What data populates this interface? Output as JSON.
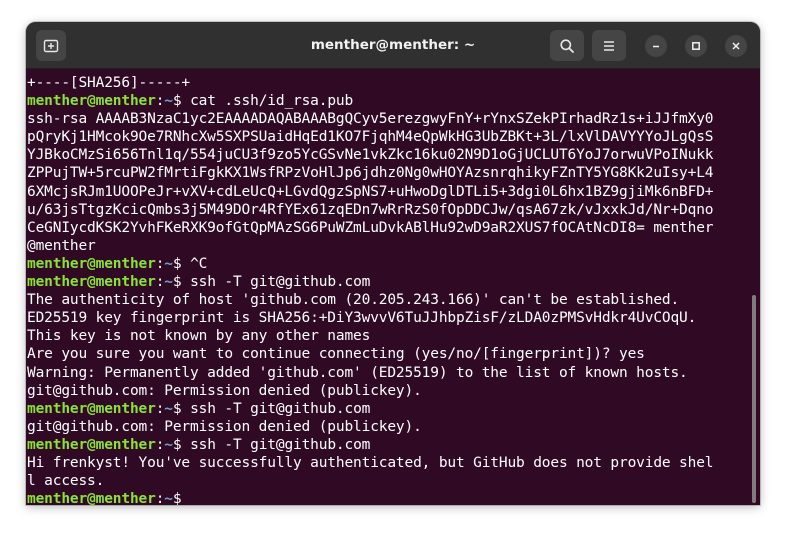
{
  "window": {
    "title": "menther@menther: ~"
  },
  "terminal": {
    "prompt_user_host": "menther@menther",
    "prompt_sep": ":",
    "prompt_path": "~",
    "prompt_symbol": "$",
    "lines": [
      {
        "kind": "output",
        "text": "+----[SHA256]-----+"
      },
      {
        "kind": "prompt",
        "cmd": " cat .ssh/id_rsa.pub"
      },
      {
        "kind": "output",
        "text": "ssh-rsa AAAAB3NzaC1yc2EAAAADAQABAAABgQCyv5erezgwyFnY+rYnxSZekPIrhadRz1s+iJJfmXy0"
      },
      {
        "kind": "output",
        "text": "pQryKj1HMcok9Oe7RNhcXw5SXPSUaidHqEd1KO7FjqhM4eQpWkHG3UbZBKt+3L/lxVlDAVYYYoJLgQsS"
      },
      {
        "kind": "output",
        "text": "YJBkoCMzSi656Tnl1q/554juCU3f9zo5YcGSvNe1vkZkc16ku02N9D1oGjUCLUT6YoJ7orwuVPoINukk"
      },
      {
        "kind": "output",
        "text": "ZPPujTW+5rcuPW2fMrtiFgkKX1WsfRPzVoHlJp6jdhz0Ng0wHOYAzsnrqhikyFZnTY5YG8Kk2uIsy+L4"
      },
      {
        "kind": "output",
        "text": "6XMcjsRJm1UOOPeJr+vXV+cdLeUcQ+LGvdQgzSpNS7+uHwoDglDTLi5+3dgi0L6hx1BZ9gjiMk6nBFD+"
      },
      {
        "kind": "output",
        "text": "u/63jsTtgzKcicQmbs3j5M49DOr4RfYEx61zqEDn7wRrRzS0fOpDDCJw/qsA67zk/vJxxkJd/Nr+Dqno"
      },
      {
        "kind": "output",
        "text": "CeGNIycdKSK2YvhFKeRXK9ofGtQpMAzSG6PuWZmLuDvkABlHu92wD9aR2XUS7fOCAtNcDI8= menther"
      },
      {
        "kind": "output",
        "text": "@menther"
      },
      {
        "kind": "prompt",
        "cmd": " ^C"
      },
      {
        "kind": "prompt",
        "cmd": " ssh -T git@github.com"
      },
      {
        "kind": "output",
        "text": "The authenticity of host 'github.com (20.205.243.166)' can't be established."
      },
      {
        "kind": "output",
        "text": "ED25519 key fingerprint is SHA256:+DiY3wvvV6TuJJhbpZisF/zLDA0zPMSvHdkr4UvCOqU."
      },
      {
        "kind": "output",
        "text": "This key is not known by any other names"
      },
      {
        "kind": "output",
        "text": "Are you sure you want to continue connecting (yes/no/[fingerprint])? yes"
      },
      {
        "kind": "output",
        "text": "Warning: Permanently added 'github.com' (ED25519) to the list of known hosts."
      },
      {
        "kind": "output",
        "text": "git@github.com: Permission denied (publickey)."
      },
      {
        "kind": "prompt",
        "cmd": " ssh -T git@github.com"
      },
      {
        "kind": "output",
        "text": "git@github.com: Permission denied (publickey)."
      },
      {
        "kind": "prompt",
        "cmd": " ssh -T git@github.com"
      },
      {
        "kind": "output",
        "text": "Hi frenkyst! You've successfully authenticated, but GitHub does not provide shel"
      },
      {
        "kind": "output",
        "text": "l access."
      },
      {
        "kind": "prompt",
        "cmd": ""
      }
    ]
  },
  "icons": {
    "new_tab": "new-tab-icon",
    "search": "search-icon",
    "menu": "hamburger-menu-icon",
    "minimize": "minimize-icon",
    "maximize": "maximize-icon",
    "close": "close-icon"
  },
  "colors": {
    "terminal_bg": "#300a24",
    "prompt_user": "#8ae234",
    "prompt_path": "#729fcf",
    "titlebar_bg": "#303030"
  }
}
